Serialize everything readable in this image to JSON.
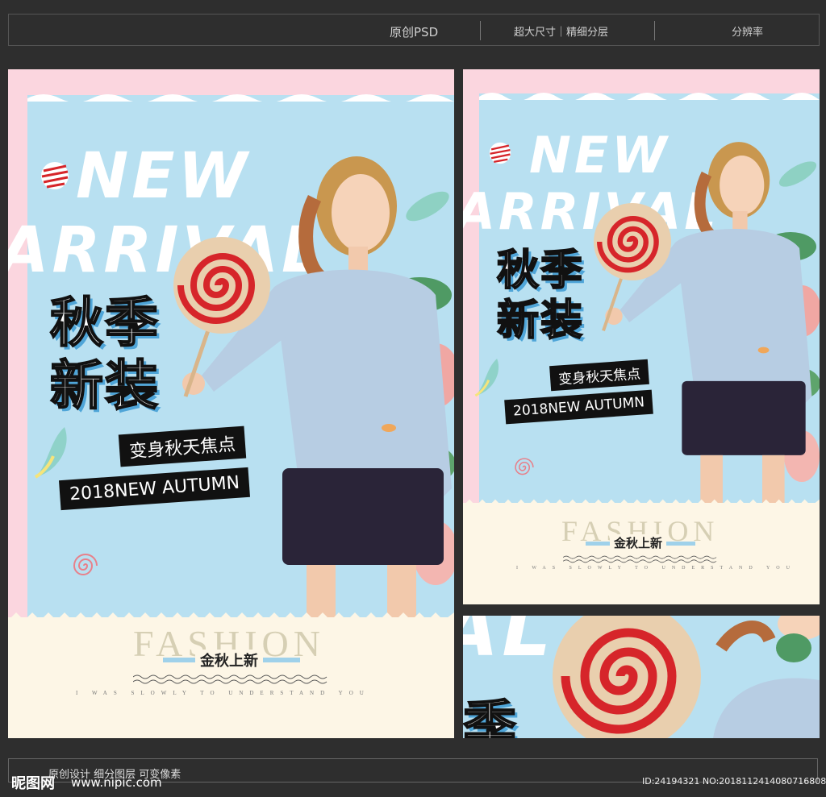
{
  "topbar": {
    "psd_label": "原创PSD",
    "size_label": "超大尺寸｜精细分层",
    "resolution_label": "分辨率"
  },
  "poster": {
    "new_arrival": "NEW ARRIVAL",
    "title_line1": "秋季",
    "title_line2": "新装",
    "tag1": "变身秋天焦点",
    "tag2": "2018NEW AUTUMN",
    "fashion": "FASHION",
    "jinqiu": "金秋上新",
    "slogan": "I WAS SLOWLY TO UNDERSTAND YOU"
  },
  "footer": {
    "original_text": "原创设计 细分图层 可变像素",
    "logo": "昵图网",
    "url": "www.nipic.com",
    "id_text": "ID:24194321 NO:20181124140807168081"
  },
  "colors": {
    "background": "#2e2e2e",
    "pink": "#fbd6df",
    "sky": "#b8e0f1",
    "cream": "#fdf6e6",
    "sweater": "#b7cde3",
    "shorts": "#2a2438",
    "lollipop_red": "#d6252a"
  },
  "icons": [
    "lollipop-icon",
    "swirl-ball-icon",
    "leaf-icon",
    "spiral-icon"
  ]
}
